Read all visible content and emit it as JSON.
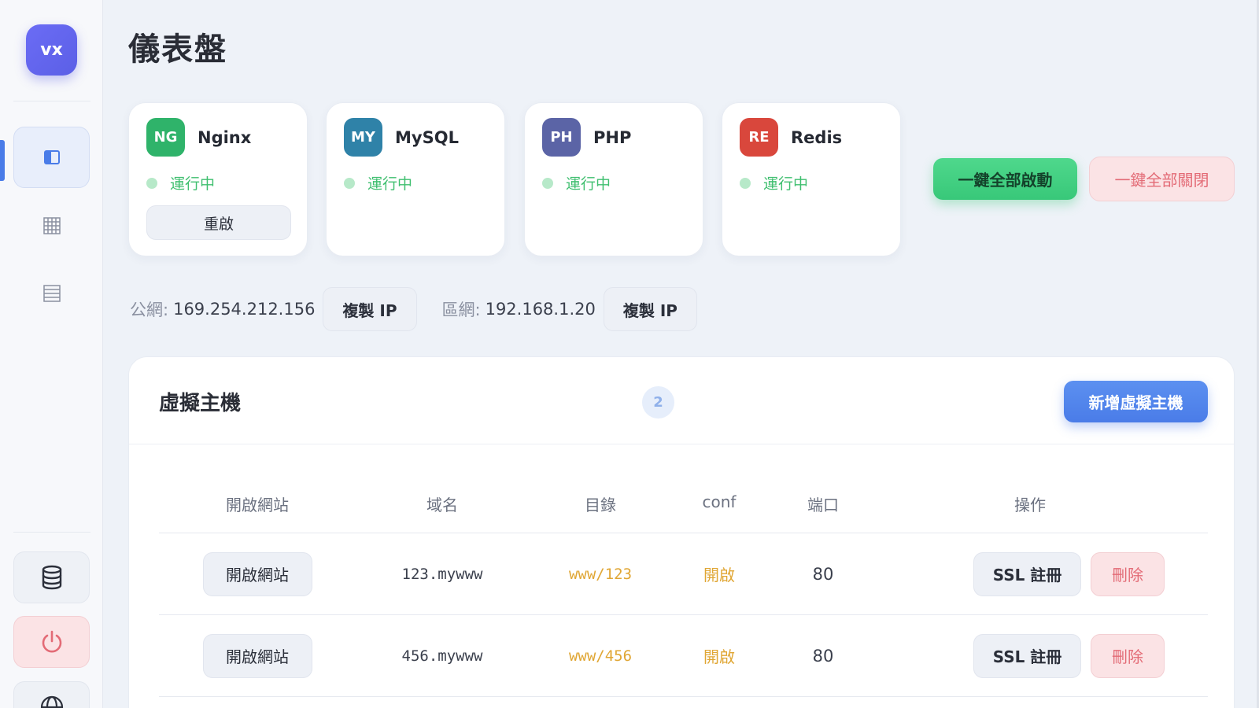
{
  "sidebar": {
    "logo": "vx",
    "items": [
      {
        "name": "dashboard",
        "icon": "panel-icon",
        "active": true
      },
      {
        "name": "grid",
        "icon": "grid-icon"
      },
      {
        "name": "list",
        "icon": "list-icon"
      }
    ],
    "bottom": [
      {
        "name": "database",
        "icon": "database-icon"
      },
      {
        "name": "power",
        "icon": "power-icon"
      },
      {
        "name": "globe",
        "icon": "globe-icon"
      }
    ]
  },
  "page": {
    "title": "儀表盤"
  },
  "services": [
    {
      "abbr": "NG",
      "name": "Nginx",
      "status": "運行中",
      "color": "#2fb36a",
      "action": "重啟"
    },
    {
      "abbr": "MY",
      "name": "MySQL",
      "status": "運行中",
      "color": "#2f82a8"
    },
    {
      "abbr": "PH",
      "name": "PHP",
      "status": "運行中",
      "color": "#5b64a6"
    },
    {
      "abbr": "RE",
      "name": "Redis",
      "status": "運行中",
      "color": "#d9473c"
    }
  ],
  "actions": {
    "start_all": "一鍵全部啟動",
    "stop_all": "一鍵全部關閉"
  },
  "network": {
    "public_label": "公網:",
    "public_ip": "169.254.212.156",
    "public_copy": "複製 IP",
    "lan_label": "區網:",
    "lan_ip": "192.168.1.20",
    "lan_copy": "複製 IP"
  },
  "vhosts": {
    "title": "虛擬主機",
    "count": "2",
    "add_label": "新增虛擬主機",
    "columns": [
      "開啟網站",
      "域名",
      "目錄",
      "conf",
      "端口",
      "操作"
    ],
    "rows": [
      {
        "open": "開啟網站",
        "domain": "123.mywww",
        "dir": "www/123",
        "conf": "開啟",
        "port": "80",
        "ssl": "SSL 註冊",
        "delete": "刪除"
      },
      {
        "open": "開啟網站",
        "domain": "456.mywww",
        "dir": "www/456",
        "conf": "開啟",
        "port": "80",
        "ssl": "SSL 註冊",
        "delete": "刪除"
      }
    ]
  },
  "colors": {
    "accent": "#4a7ce8",
    "success": "#38c879",
    "danger": "#e36b76",
    "warning": "#e0a634"
  }
}
